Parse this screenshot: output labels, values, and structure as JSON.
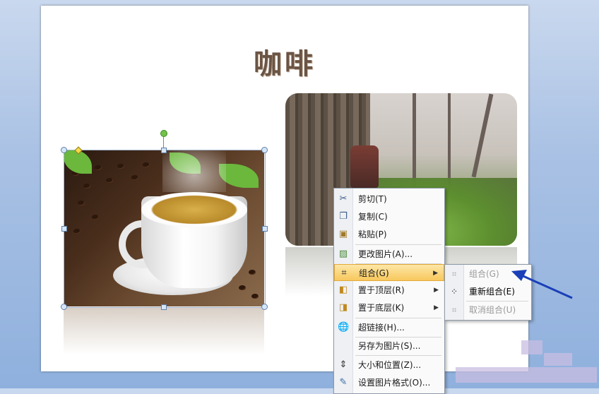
{
  "slide": {
    "title": "咖啡"
  },
  "context_menu": {
    "items": [
      {
        "label": "剪切(T)",
        "icon": "scissors-icon"
      },
      {
        "label": "复制(C)",
        "icon": "copy-icon"
      },
      {
        "label": "粘贴(P)",
        "icon": "paste-icon"
      },
      {
        "label": "更改图片(A)...",
        "icon": "change-picture-icon"
      },
      {
        "label": "组合(G)",
        "icon": "group-icon",
        "submenu": true,
        "active": true
      },
      {
        "label": "置于顶层(R)",
        "icon": "bring-to-front-icon",
        "submenu": true
      },
      {
        "label": "置于底层(K)",
        "icon": "send-to-back-icon",
        "submenu": true
      },
      {
        "label": "超链接(H)...",
        "icon": "hyperlink-icon"
      },
      {
        "label": "另存为图片(S)..."
      },
      {
        "label": "大小和位置(Z)...",
        "icon": "size-position-icon"
      },
      {
        "label": "设置图片格式(O)...",
        "icon": "format-picture-icon"
      }
    ]
  },
  "group_submenu": {
    "items": [
      {
        "label": "组合(G)",
        "icon": "group-icon",
        "enabled": false
      },
      {
        "label": "重新组合(E)",
        "icon": "regroup-icon",
        "enabled": true
      },
      {
        "label": "取消组合(U)",
        "icon": "ungroup-icon",
        "enabled": false
      }
    ]
  },
  "colors": {
    "menu_highlight": "#f8c85d",
    "annotation_arrow": "#1a3fb8",
    "title_text": "#6b5444"
  }
}
